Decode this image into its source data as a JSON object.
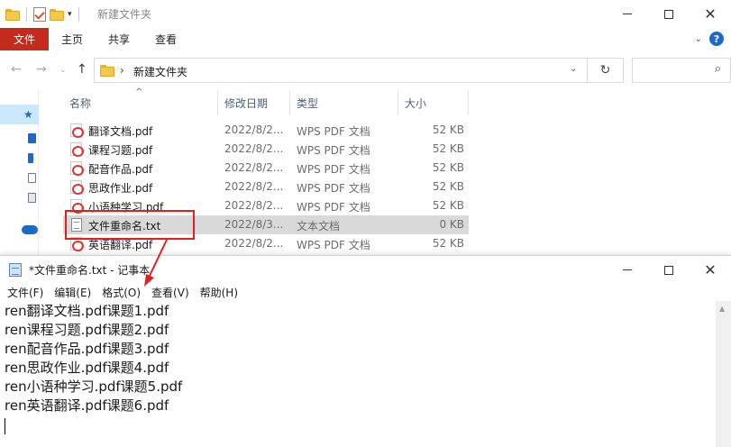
{
  "explorer": {
    "window_title": "新建文件夹",
    "ribbon_tabs": [
      "文件",
      "主页",
      "共享",
      "查看"
    ],
    "breadcrumb": "新建文件夹",
    "columns": {
      "name": "名称",
      "date": "修改日期",
      "type": "类型",
      "size": "大小"
    },
    "files": [
      {
        "name": "翻译文档.pdf",
        "date": "2022/8/2...",
        "type": "WPS PDF 文档",
        "size": "52 KB",
        "icon": "pdf-icon"
      },
      {
        "name": "课程习题.pdf",
        "date": "2022/8/2...",
        "type": "WPS PDF 文档",
        "size": "52 KB",
        "icon": "pdf-icon"
      },
      {
        "name": "配音作品.pdf",
        "date": "2022/8/2...",
        "type": "WPS PDF 文档",
        "size": "52 KB",
        "icon": "pdf-icon"
      },
      {
        "name": "思政作业.pdf",
        "date": "2022/8/2...",
        "type": "WPS PDF 文档",
        "size": "52 KB",
        "icon": "pdf-icon"
      },
      {
        "name": "小语种学习.pdf",
        "date": "2022/8/2...",
        "type": "WPS PDF 文档",
        "size": "52 KB",
        "icon": "pdf-icon"
      },
      {
        "name": "文件重命名.txt",
        "date": "2022/8/3...",
        "type": "文本文档",
        "size": "0 KB",
        "icon": "txt-icon",
        "selected": true
      },
      {
        "name": "英语翻译.pdf",
        "date": "2022/8/2...",
        "type": "WPS PDF 文档",
        "size": "52 KB",
        "icon": "pdf-icon"
      }
    ],
    "help_glyph": "?"
  },
  "notepad": {
    "title": "*文件重命名.txt - 记事本",
    "menus": [
      "文件(F)",
      "编辑(E)",
      "格式(O)",
      "查看(V)",
      "帮助(H)"
    ],
    "lines": [
      "ren翻译文档.pdf课题1.pdf",
      "ren课程习题.pdf课题2.pdf",
      "ren配音作品.pdf课题3.pdf",
      "ren思政作业.pdf课题4.pdf",
      "ren小语种学习.pdf课题5.pdf",
      "ren英语翻译.pdf课题6.pdf"
    ]
  },
  "annotation": {
    "highlight_color": "#e0201d"
  }
}
